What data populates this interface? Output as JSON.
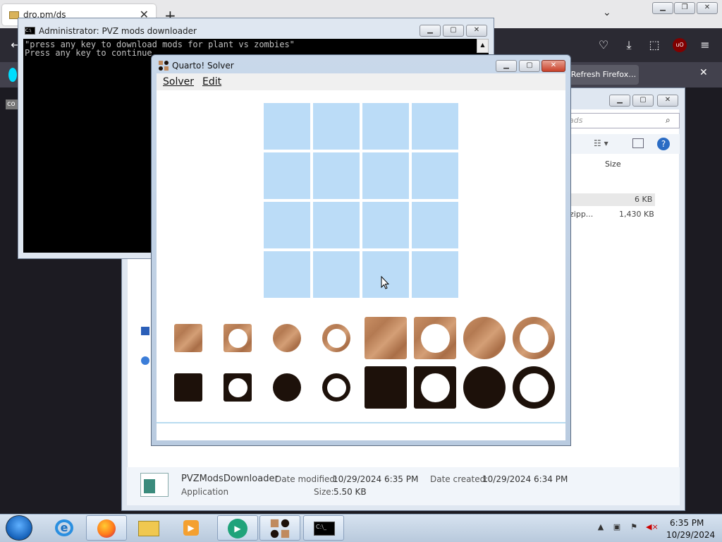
{
  "firefox": {
    "tab_title": "dro.pm/ds",
    "notification_button": "Refresh Firefox…",
    "left_badge": "co"
  },
  "explorer": {
    "search_placeholder": "ads",
    "column_size": "Size",
    "rows": [
      {
        "name": "",
        "size": "6 KB"
      },
      {
        "name": "zipp...",
        "size": "1,430 KB"
      }
    ],
    "details": {
      "file_name": "PVZModsDownloader",
      "file_type": "Application",
      "date_modified_label": "Date modified:",
      "date_modified": "10/29/2024 6:35 PM",
      "date_created_label": "Date created:",
      "date_created": "10/29/2024 6:34 PM",
      "size_label": "Size:",
      "size": "5.50 KB"
    }
  },
  "cmd": {
    "title": "Administrator:  PVZ mods downloader",
    "line1": "\"press any key to download mods for plant vs zombies\"",
    "line2": "Press any key to continue . . ."
  },
  "quarto": {
    "title": "Quarto! Solver",
    "menus": [
      "Solver",
      "Edit"
    ],
    "board": {
      "rows": 4,
      "cols": 4,
      "filled": 0
    },
    "pieces": [
      {
        "color": "light",
        "shape": "square",
        "hollow": false,
        "size": "small"
      },
      {
        "color": "light",
        "shape": "square",
        "hollow": true,
        "size": "small"
      },
      {
        "color": "light",
        "shape": "circle",
        "hollow": false,
        "size": "small"
      },
      {
        "color": "light",
        "shape": "circle",
        "hollow": true,
        "size": "small"
      },
      {
        "color": "light",
        "shape": "square",
        "hollow": false,
        "size": "large"
      },
      {
        "color": "light",
        "shape": "square",
        "hollow": true,
        "size": "large"
      },
      {
        "color": "light",
        "shape": "circle",
        "hollow": false,
        "size": "large"
      },
      {
        "color": "light",
        "shape": "circle",
        "hollow": true,
        "size": "large"
      },
      {
        "color": "dark",
        "shape": "square",
        "hollow": false,
        "size": "small"
      },
      {
        "color": "dark",
        "shape": "square",
        "hollow": true,
        "size": "small"
      },
      {
        "color": "dark",
        "shape": "circle",
        "hollow": false,
        "size": "small"
      },
      {
        "color": "dark",
        "shape": "circle",
        "hollow": true,
        "size": "small"
      },
      {
        "color": "dark",
        "shape": "square",
        "hollow": false,
        "size": "large"
      },
      {
        "color": "dark",
        "shape": "square",
        "hollow": true,
        "size": "large"
      },
      {
        "color": "dark",
        "shape": "circle",
        "hollow": false,
        "size": "large"
      },
      {
        "color": "dark",
        "shape": "circle",
        "hollow": true,
        "size": "large"
      }
    ]
  },
  "taskbar": {
    "apps": [
      "internet-explorer",
      "firefox",
      "file-explorer",
      "media-player",
      "app-green",
      "quarto-solver",
      "command-prompt"
    ],
    "time": "6:35 PM",
    "date": "10/29/2024"
  },
  "colors": {
    "board_cell": "#bbdcf7",
    "light_piece": "#c08a5e",
    "dark_piece": "#1d110a",
    "cmd_bg": "#000000",
    "ff_toolbar": "#2b2a33"
  }
}
